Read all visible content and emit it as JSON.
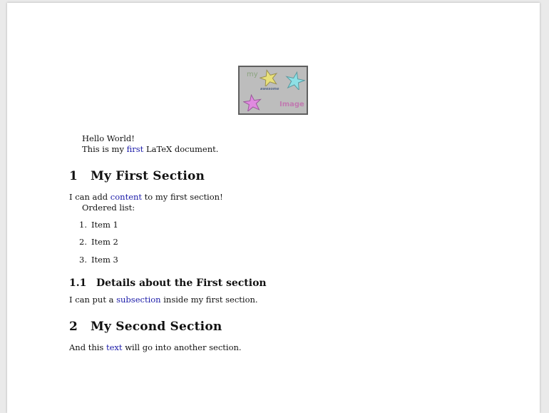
{
  "figure": {
    "word_my": "my",
    "word_awesome": "awesome",
    "word_image": "Image"
  },
  "intro": {
    "line1": "Hello World!",
    "line2_pre": "This is my ",
    "line2_kw": "first",
    "line2_post": " LaTeX document."
  },
  "section1": {
    "number": "1",
    "title": "My First Section",
    "body_pre": "I can add ",
    "body_kw": "content",
    "body_post": " to my first section!",
    "list_label": "Ordered list:",
    "items": [
      {
        "marker": "1.",
        "text": "Item 1"
      },
      {
        "marker": "2.",
        "text": "Item 2"
      },
      {
        "marker": "3.",
        "text": "Item 3"
      }
    ]
  },
  "subsection1": {
    "number": "1.1",
    "title": "Details about the First section",
    "body_pre": "I can put a ",
    "body_kw": "subsection",
    "body_post": " inside my first section."
  },
  "section2": {
    "number": "2",
    "title": "My Second Section",
    "body_pre": "And this ",
    "body_kw": "text",
    "body_post": " will go into another section."
  },
  "colors": {
    "keyword": "#1a1aa8",
    "figure_bg": "#bdbdbd",
    "figure_border": "#5f5f5f"
  }
}
